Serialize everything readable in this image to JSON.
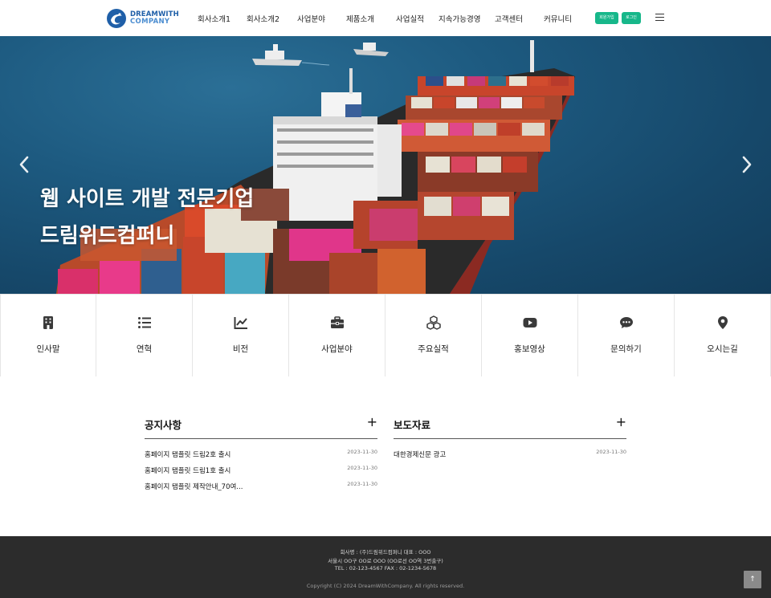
{
  "logo": {
    "line1": "DREAMWITH",
    "line2": "COMPANY"
  },
  "nav": [
    "회사소개1",
    "회사소개2",
    "사업분야",
    "제품소개",
    "사업실적",
    "지속가능경영",
    "고객센터",
    "커뮤니티"
  ],
  "header_buttons": {
    "signup": "회원가입",
    "login": "로그인"
  },
  "hero": {
    "line1": "웹 사이트 개발 전문기업",
    "line2": "드림위드컴퍼니"
  },
  "quick_menu": [
    {
      "label": "인사말",
      "icon": "building-icon"
    },
    {
      "label": "연혁",
      "icon": "list-icon"
    },
    {
      "label": "비전",
      "icon": "chart-line-icon"
    },
    {
      "label": "사업분야",
      "icon": "briefcase-icon"
    },
    {
      "label": "주요실적",
      "icon": "cubes-icon"
    },
    {
      "label": "홍보영상",
      "icon": "youtube-icon"
    },
    {
      "label": "문의하기",
      "icon": "comment-dots-icon"
    },
    {
      "label": "오시는길",
      "icon": "map-pin-icon"
    }
  ],
  "notice": {
    "title": "공지사항",
    "more": "+",
    "posts": [
      {
        "title": "홈페이지 탬플릿 드림2호 출시",
        "date": "2023-11-30"
      },
      {
        "title": "홈페이지 탬플릿 드림1호 출시",
        "date": "2023-11-30"
      },
      {
        "title": "홈페이지 탬플릿 제작안내_70여...",
        "date": "2023-11-30"
      }
    ]
  },
  "press": {
    "title": "보도자료",
    "more": "+",
    "posts": [
      {
        "title": "대한경제신문 광고",
        "date": "2023-11-30"
      }
    ]
  },
  "footer": {
    "line1": "회사명 : (주)드림위드컴퍼니 대표 : OOO",
    "line2": "서울시 OO구 OO로 OOO (OO로선 OO역 3번출구)",
    "line3": "TEL : 02-123-4567 FAX : 02-1234-5678",
    "copyright": "Copyright (C) 2024 DreamWithCompany. All rights reserved."
  },
  "top_button": "↑",
  "colors": {
    "accent": "#17b78a",
    "logo": "#1f5fa8",
    "footer_bg": "#2c2c2c"
  }
}
